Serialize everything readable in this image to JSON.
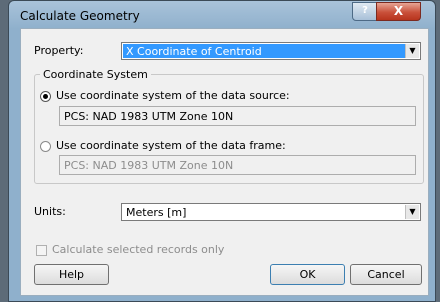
{
  "window": {
    "title": "Calculate Geometry",
    "help_glyph": "?",
    "close_glyph": "X"
  },
  "property": {
    "label": "Property:",
    "value": "X Coordinate of Centroid"
  },
  "coordinate_system": {
    "group_label": "Coordinate System",
    "data_source_option": "Use coordinate system of the data source:",
    "data_source_value": "PCS: NAD 1983 UTM Zone 10N",
    "data_frame_option": "Use coordinate system of the data frame:",
    "data_frame_value": "PCS: NAD 1983 UTM Zone 10N",
    "selected": "data_source"
  },
  "units": {
    "label": "Units:",
    "value": "Meters [m]"
  },
  "selected_only": {
    "label": "Calculate selected records only",
    "checked": false,
    "enabled": false
  },
  "buttons": {
    "help": "Help",
    "ok": "OK",
    "cancel": "Cancel"
  },
  "icons": {
    "dropdown": "chevron-down-icon"
  }
}
